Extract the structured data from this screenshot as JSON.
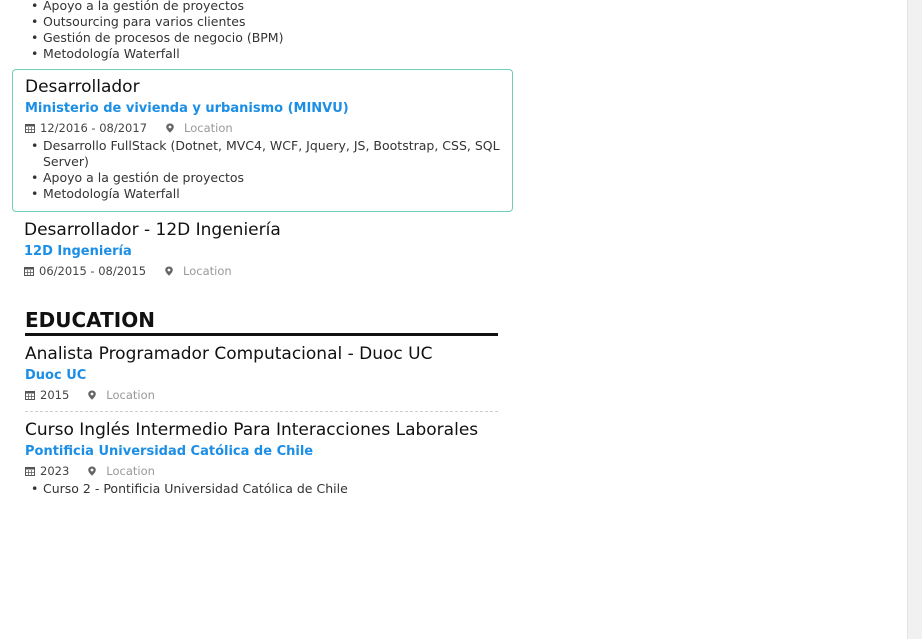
{
  "top_bullets": [
    "Apoyo a la gestión de proyectos",
    "Outsourcing para varios clientes",
    "Gestión de procesos de negocio (BPM)",
    "Metodología Waterfall"
  ],
  "experience": [
    {
      "role": "Desarrollador",
      "org": "Ministerio de vivienda y urbanismo (MINVU)",
      "dates": "12/2016 - 08/2017",
      "location": "Location",
      "bullets": [
        "Desarrollo FullStack (Dotnet, MVC4, WCF, Jquery, JS, Bootstrap, CSS, SQL Server)",
        "Apoyo a la gestión de proyectos",
        "Metodología Waterfall"
      ]
    },
    {
      "role": "Desarrollador - 12D Ingeniería",
      "org": "12D Ingeniería",
      "dates": "06/2015 - 08/2015",
      "location": "Location"
    }
  ],
  "education_title": "EDUCATION",
  "education": [
    {
      "degree": "Analista Programador Computacional - Duoc UC",
      "school": "Duoc UC",
      "year": "2015",
      "location": "Location"
    },
    {
      "degree": "Curso Inglés Intermedio Para Interacciones Laborales",
      "school": "Pontificia Universidad Católica de Chile",
      "year": "2023",
      "location": "Location",
      "bullets": [
        "Curso 2 - Pontificia Universidad Católica de Chile"
      ]
    }
  ],
  "colors": {
    "link": "#1b8ee6",
    "highlight_border": "#6fcfb8"
  },
  "icons": {
    "date": "calendar-icon",
    "location": "map-pin-icon"
  }
}
